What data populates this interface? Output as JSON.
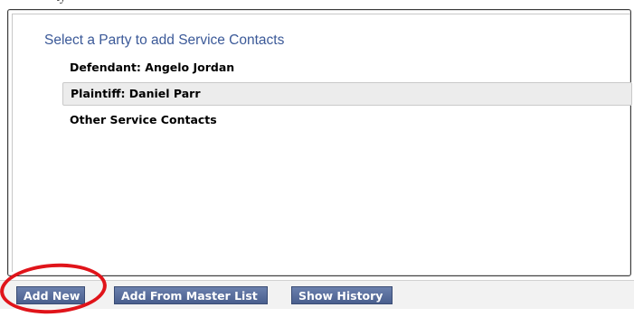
{
  "top_clip_text": "ty",
  "panel": {
    "heading": "Select a Party to add Service Contacts",
    "parties": [
      {
        "label": "Defendant: Angelo Jordan",
        "selected": false
      },
      {
        "label": "Plaintiff: Daniel Parr",
        "selected": true
      },
      {
        "label": "Other Service Contacts",
        "selected": false
      }
    ]
  },
  "toolbar": {
    "add_new_label": "Add New",
    "add_from_master_label": "Add From Master List",
    "show_history_label": "Show History"
  },
  "colors": {
    "heading": "#3b5998",
    "button_bg": "#5a6f9e",
    "selected_row_bg": "#ececec",
    "annotation": "#e0141a"
  }
}
